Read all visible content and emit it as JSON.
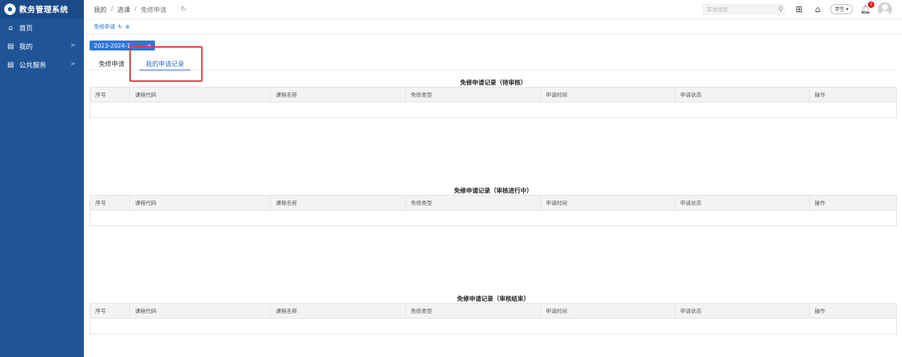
{
  "app": {
    "title": "教务管理系统"
  },
  "sidebar": {
    "items": [
      {
        "label": "首页",
        "icon": "home-icon",
        "has_children": false
      },
      {
        "label": "我的",
        "icon": "document-icon",
        "has_children": true
      },
      {
        "label": "公共服务",
        "icon": "document-icon",
        "has_children": true
      }
    ]
  },
  "header": {
    "breadcrumb": [
      "我的",
      "选课",
      "免修申请"
    ],
    "search_placeholder": "菜单搜索",
    "role": "学生",
    "notification_count": "0"
  },
  "page_tabs": [
    {
      "label": "免修申请"
    }
  ],
  "content": {
    "semester": "2023-2024-1",
    "tabs": [
      {
        "label": "免修申请",
        "active": false
      },
      {
        "label": "我的申请记录",
        "active": true
      }
    ],
    "columns": [
      "序号",
      "课程代码",
      "课程名称",
      "免修类型",
      "申请时间",
      "申请状态",
      "操作"
    ],
    "sections": [
      {
        "title": "免修申请记录（待审核）",
        "rows": []
      },
      {
        "title": "免修申请记录（审核进行中）",
        "rows": []
      },
      {
        "title": "免修申请记录（审核结束）",
        "rows": []
      }
    ]
  },
  "colors": {
    "sidebar": "#1f5597",
    "accent": "#2b6ed2",
    "highlight": "#e53a3a"
  }
}
